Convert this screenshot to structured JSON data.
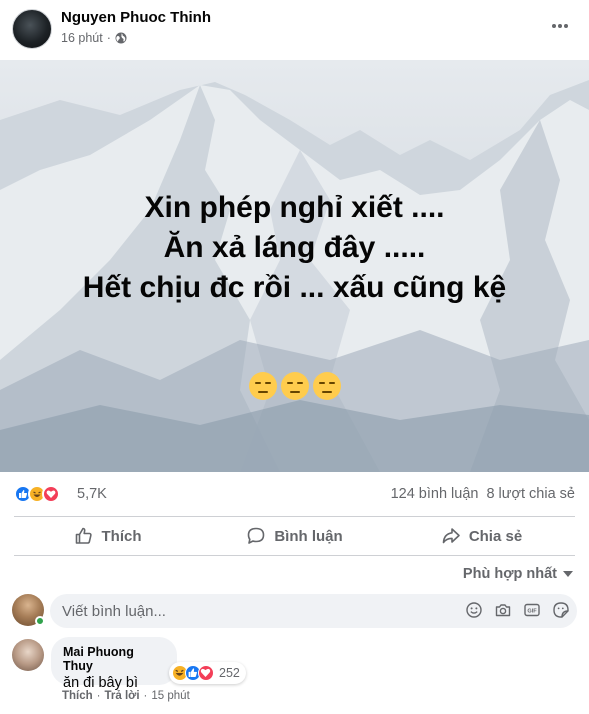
{
  "post": {
    "author": "Nguyen Phuoc Thinh",
    "time": "16 phút",
    "privacy_icon": "globe-icon",
    "image_text": {
      "line1": "Xin phép nghỉ xiết ....",
      "line2": "Ăn xả láng đây .....",
      "line3": "Hết chịu đc rồi ... xấu cũng kệ"
    },
    "emojis": [
      "expressionless-face",
      "expressionless-face",
      "expressionless-face"
    ]
  },
  "stats": {
    "reaction_types": [
      "like",
      "haha",
      "love"
    ],
    "reaction_count": "5,7K",
    "comments": "124 bình luận",
    "shares": "8 lượt chia sẻ"
  },
  "actions": {
    "like": "Thích",
    "comment": "Bình luận",
    "share": "Chia sẻ"
  },
  "comments_section": {
    "sort_label": "Phù hợp nhất",
    "composer_placeholder": "Viết bình luận...",
    "composer_icons": [
      "smiley-icon",
      "camera-icon",
      "gif-icon",
      "sticker-icon"
    ],
    "comments": [
      {
        "author": "Mai Phuong Thuy",
        "text": "ăn đi bây bì",
        "reaction_types": [
          "haha",
          "like",
          "love"
        ],
        "reaction_count": "252",
        "like_label": "Thích",
        "reply_label": "Trả lời",
        "time": "15 phút"
      }
    ]
  },
  "colors": {
    "primary_text": "#050505",
    "secondary_text": "#65676b",
    "like_blue": "#1877f2",
    "love_red": "#f33e58",
    "haha_yellow": "#f7b125",
    "input_bg": "#f0f2f5"
  }
}
